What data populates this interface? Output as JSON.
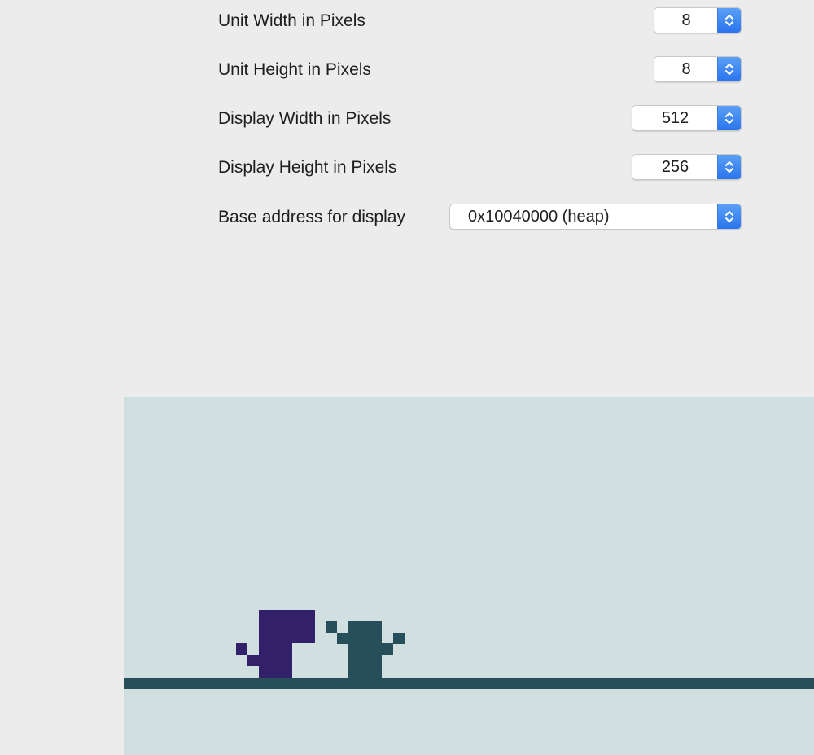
{
  "settings": {
    "unit_width": {
      "label": "Unit Width in Pixels",
      "value": "8"
    },
    "unit_height": {
      "label": "Unit Height in Pixels",
      "value": "8"
    },
    "display_width": {
      "label": "Display Width in Pixels",
      "value": "512"
    },
    "display_height": {
      "label": "Display Height in Pixels",
      "value": "256"
    },
    "base_address": {
      "label": "Base address for display",
      "value": "0x10040000 (heap)"
    }
  },
  "icons": {
    "stepper": "up-down-chevron-icon"
  },
  "colors": {
    "background": "#ececec",
    "display_background": "#d2dfe0",
    "ground": "#264f5a",
    "player": "#33206a",
    "cactus": "#264f5a",
    "stepper_accent": "#2a74ee"
  }
}
